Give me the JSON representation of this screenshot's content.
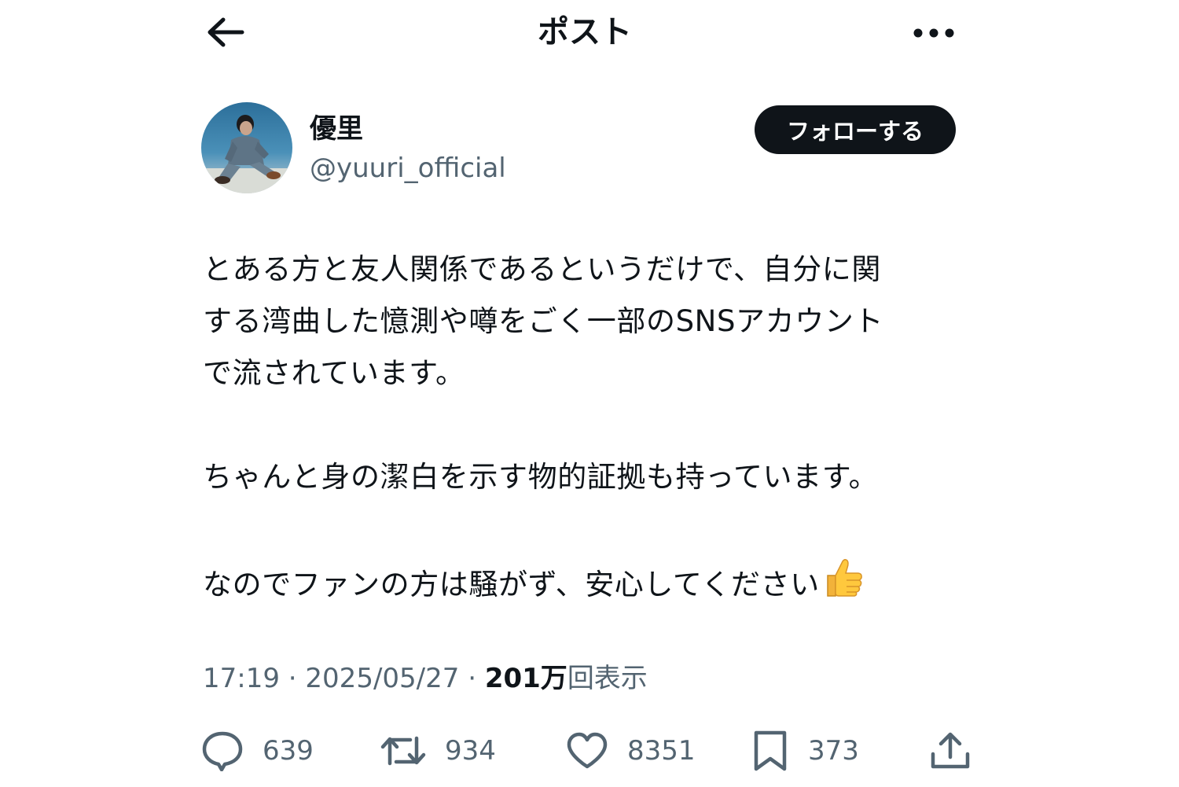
{
  "header": {
    "title": "ポスト"
  },
  "author": {
    "display_name": "優里",
    "handle": "@yuuri_official",
    "follow_label": "フォローする"
  },
  "post": {
    "lines": [
      "とある方と友人関係であるというだけで、自分に関",
      "する湾曲した憶測や噂をごく一部のSNSアカウント",
      "で流されています。",
      "ちゃんと身の潔白を示す物的証拠も持っています。",
      "なのでファンの方は騒がず、安心してください"
    ]
  },
  "meta": {
    "time": "17:19",
    "date": "2025/05/27",
    "views_count": "201万",
    "views_label": "回表示"
  },
  "actions": {
    "replies": "639",
    "reposts": "934",
    "likes": "8351",
    "bookmarks": "373"
  },
  "icons": {
    "back": "arrow-left-icon",
    "more": "more-dots-icon",
    "reply": "reply-bubble-icon",
    "repost": "repost-icon",
    "like": "heart-icon",
    "bookmark": "bookmark-icon",
    "share": "share-upload-icon",
    "emoji": "thumbs-up-emoji"
  },
  "colors": {
    "text": "#0f1419",
    "secondary": "#536471",
    "button_bg": "#0f1419",
    "button_text": "#ffffff"
  }
}
